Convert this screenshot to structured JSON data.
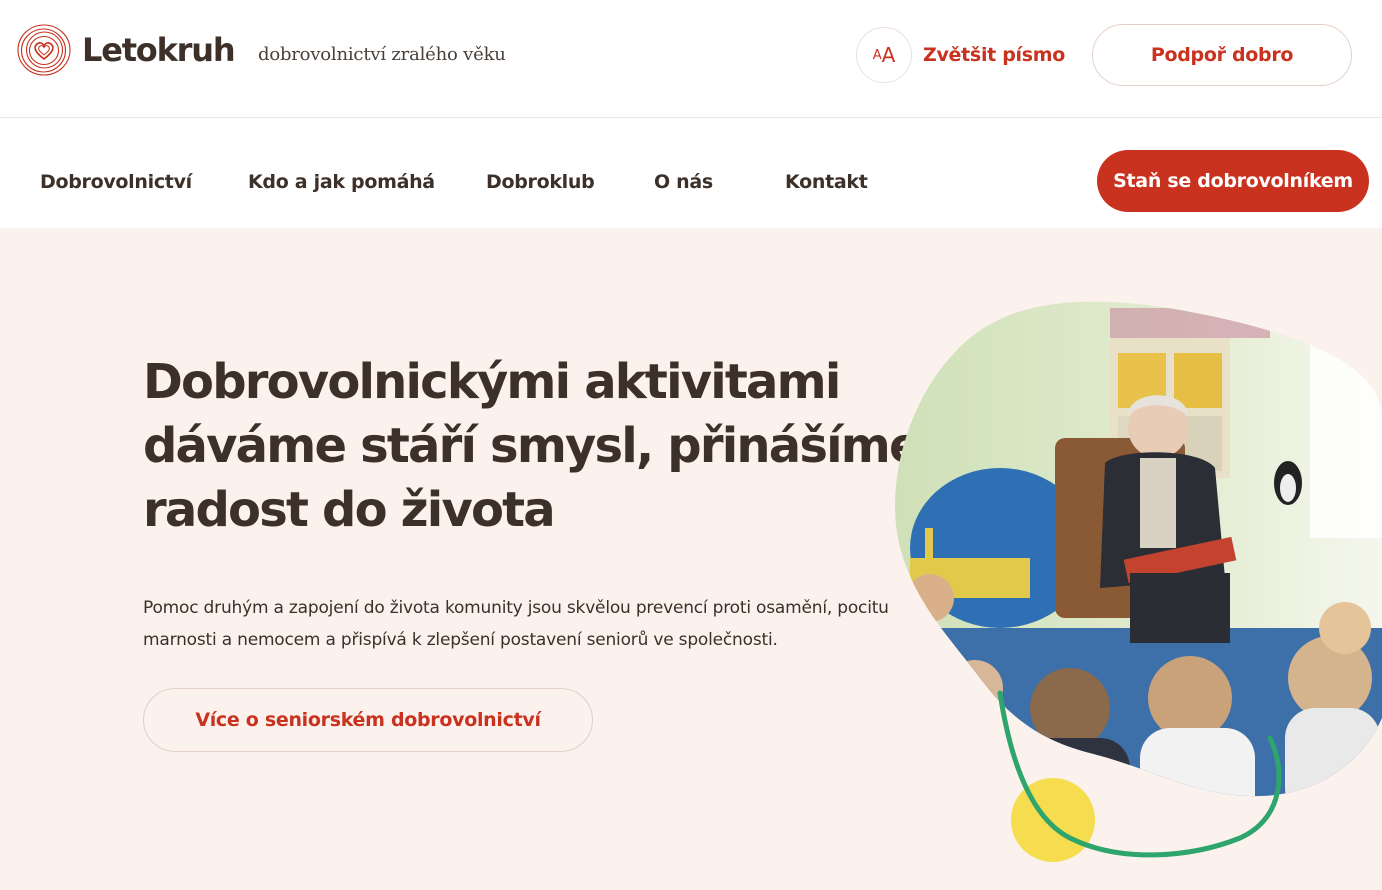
{
  "brand": {
    "name": "Letokruh",
    "tagline": "dobrovolnictví zralého věku",
    "color": "#c8321f"
  },
  "header": {
    "font_toggle_small": "A",
    "font_toggle_big": "A",
    "font_toggle_label": "Zvětšit písmo",
    "support_label": "Podpoř dobro"
  },
  "nav": {
    "items": [
      {
        "label": "Dobrovolnictví"
      },
      {
        "label": "Kdo a jak pomáhá"
      },
      {
        "label": "Dobroklub"
      },
      {
        "label": "O nás"
      },
      {
        "label": "Kontakt"
      }
    ],
    "cta_label": "Staň se dobrovolníkem"
  },
  "hero": {
    "title_lines": [
      "Dobrovolnickými aktivitami",
      "dáváme stáří smysl, přinášíme",
      "radost do života"
    ],
    "text_lines": [
      "Pomoc druhým a zapojení do života komunity jsou skvělou prevencí proti osamění, pocitu",
      "marnosti a nemocem a přispívá k zlepšení postavení seniorů ve společnosti."
    ],
    "button_label": "Více o seniorském dobrovolnictví"
  },
  "icons": {
    "logo": "tree-ring-heart-icon",
    "font_size": "font-size-icon"
  },
  "colors": {
    "accent": "#c8321f",
    "hero_bg": "#fbf1ed",
    "text": "#3d3028",
    "decor_green": "#2ea56c",
    "decor_yellow": "#f6dd4f"
  }
}
